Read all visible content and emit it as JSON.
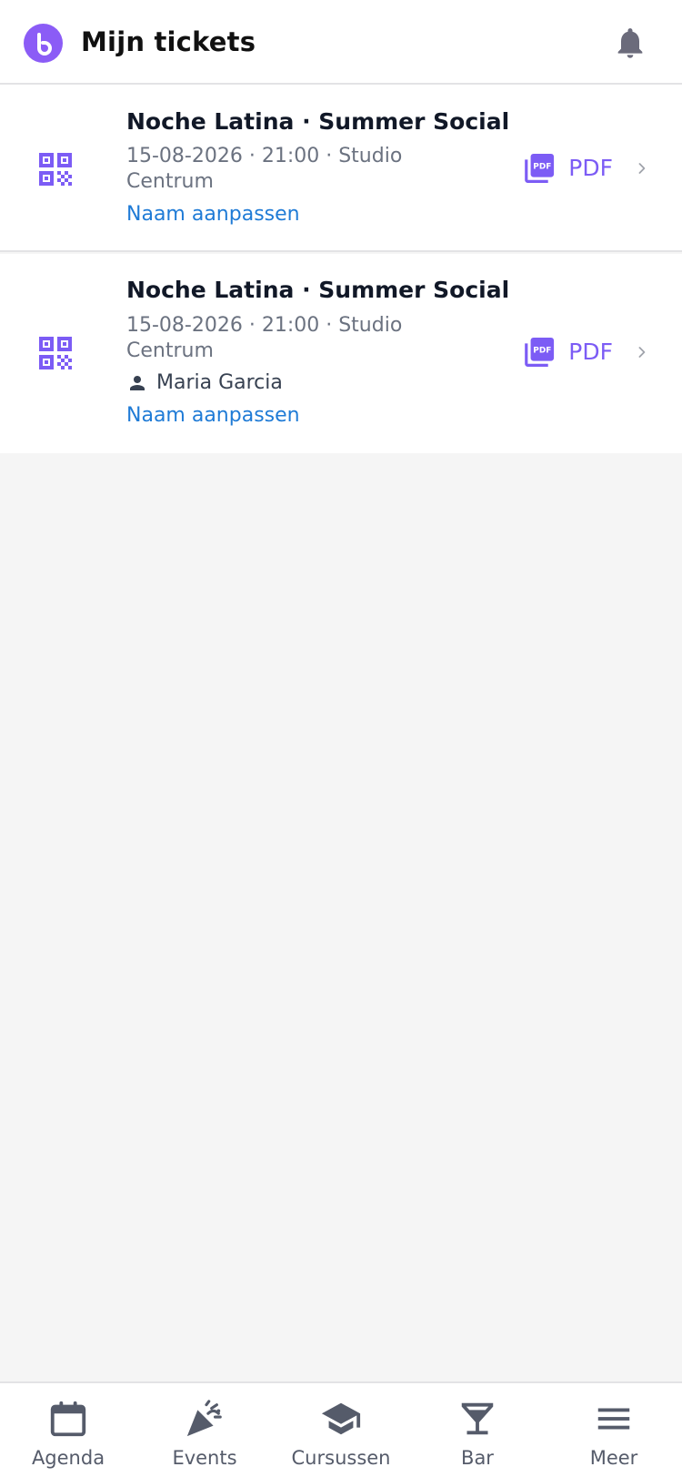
{
  "header": {
    "title": "Mijn tickets",
    "logo_icon": "brand-b-logo",
    "notification_icon": "bell-icon"
  },
  "colors": {
    "accent": "#7c5cf5",
    "brand": "#8b5cf6",
    "link": "#1f7bd6",
    "icon_gray": "#6b6b7b",
    "background": "#f5f5f5"
  },
  "tickets": [
    {
      "name": "Noche Latina · Summer Social",
      "meta": "15-08-2026 · 21:00 · Studio Centrum",
      "holder": "",
      "rename_label": "Naam aanpassen",
      "pdf_label": "PDF"
    },
    {
      "name": "Noche Latina · Summer Social",
      "meta": "15-08-2026 · 21:00 · Studio Centrum",
      "holder": "Maria Garcia",
      "rename_label": "Naam aanpassen",
      "pdf_label": "PDF"
    }
  ],
  "nav": {
    "items": [
      {
        "label": "Agenda",
        "icon": "calendar-icon"
      },
      {
        "label": "Events",
        "icon": "party-popper-icon"
      },
      {
        "label": "Cursussen",
        "icon": "graduation-cap-icon"
      },
      {
        "label": "Bar",
        "icon": "cocktail-glass-icon"
      },
      {
        "label": "Meer",
        "icon": "menu-icon"
      }
    ]
  }
}
